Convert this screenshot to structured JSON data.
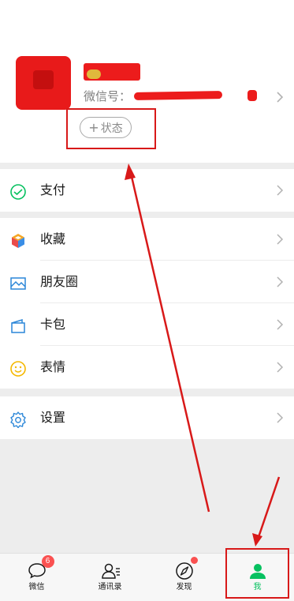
{
  "profile": {
    "wechat_id_label": "微信号：",
    "status_button": {
      "plus": "+",
      "label": "状态"
    }
  },
  "menu": {
    "pay": {
      "label": "支付",
      "icon": "wallet-icon"
    },
    "favorites": {
      "label": "收藏",
      "icon": "cube-icon"
    },
    "moments": {
      "label": "朋友圈",
      "icon": "image-icon"
    },
    "cards": {
      "label": "卡包",
      "icon": "card-icon"
    },
    "stickers": {
      "label": "表情",
      "icon": "smile-icon"
    },
    "settings": {
      "label": "设置",
      "icon": "gear-icon"
    }
  },
  "tabbar": {
    "chats": {
      "label": "微信",
      "badge": "6",
      "icon": "chat-bubble-icon"
    },
    "contacts": {
      "label": "通讯录",
      "icon": "contacts-icon"
    },
    "discover": {
      "label": "发现",
      "icon": "compass-icon"
    },
    "me": {
      "label": "我",
      "icon": "person-icon"
    }
  },
  "colors": {
    "accent_green": "#07c160",
    "annotation_red": "#d81919",
    "badge_red": "#fa5151",
    "menu_icon_blue": "#2a86d8"
  }
}
